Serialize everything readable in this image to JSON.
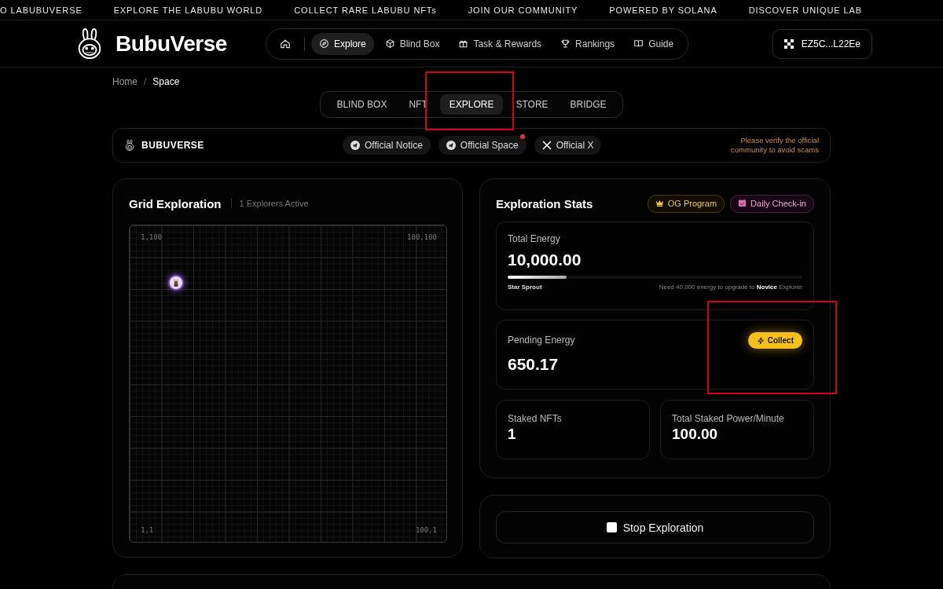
{
  "ticker": [
    "O LABUBUVERSE",
    "EXPLORE THE LABUBU WORLD",
    "COLLECT RARE LABUBU NFTs",
    "JOIN OUR COMMUNITY",
    "POWERED BY SOLANA",
    "DISCOVER UNIQUE LAB"
  ],
  "header": {
    "brand": "BubuVerse",
    "nav": [
      {
        "label": "Explore",
        "kind": "compass",
        "selected": true
      },
      {
        "label": "Blind Box",
        "kind": "cube",
        "selected": false
      },
      {
        "label": "Task & Rewards",
        "kind": "gift",
        "selected": false
      },
      {
        "label": "Rankings",
        "kind": "trophy",
        "selected": false
      },
      {
        "label": "Guide",
        "kind": "book",
        "selected": false
      }
    ],
    "wallet": "EZ5C...L22Ee"
  },
  "breadcrumb": {
    "items": [
      "Home",
      "Space"
    ],
    "separator": "/"
  },
  "tabs": [
    {
      "label": "BLIND BOX",
      "selected": false,
      "highlighted": false
    },
    {
      "label": "NFT",
      "selected": false,
      "highlighted": false
    },
    {
      "label": "EXPLORE",
      "selected": true,
      "highlighted": true
    },
    {
      "label": "STORE",
      "selected": false,
      "highlighted": false
    },
    {
      "label": "BRIDGE",
      "selected": false,
      "highlighted": false
    }
  ],
  "community": {
    "name": "BUBUVERSE",
    "links": [
      {
        "label": "Official Notice",
        "kind": "telegram",
        "badge": false
      },
      {
        "label": "Official Space",
        "kind": "telegram",
        "badge": true
      },
      {
        "label": "Official X",
        "kind": "x",
        "badge": false
      }
    ],
    "warning": "Please verify the official community to avoid scams"
  },
  "grid": {
    "title": "Grid Exploration",
    "subtitle": "1 Explorers Active",
    "corners": [
      "1,100",
      "100,100",
      "1,1",
      "100,1"
    ]
  },
  "stats": {
    "title": "Exploration Stats",
    "badges": [
      {
        "label": "OG Program",
        "kind": "og"
      },
      {
        "label": "Daily Check-in",
        "kind": "checkin"
      }
    ],
    "total": {
      "label": "Total Energy",
      "value": "10,000.00",
      "level": 0.2,
      "rank": "Star Sprout",
      "hint": "Need 40,000 energy to upgrade to **Novice** Explorer"
    },
    "pending": {
      "label": "Pending Energy",
      "value": "650.17",
      "button": "Collect",
      "highlighted": true
    },
    "small": [
      {
        "label": "Staked NFTs",
        "value": "1"
      },
      {
        "label": "Total Staked Power/Minute",
        "value": "100.00"
      }
    ]
  },
  "action": {
    "label": "Stop Exploration"
  }
}
